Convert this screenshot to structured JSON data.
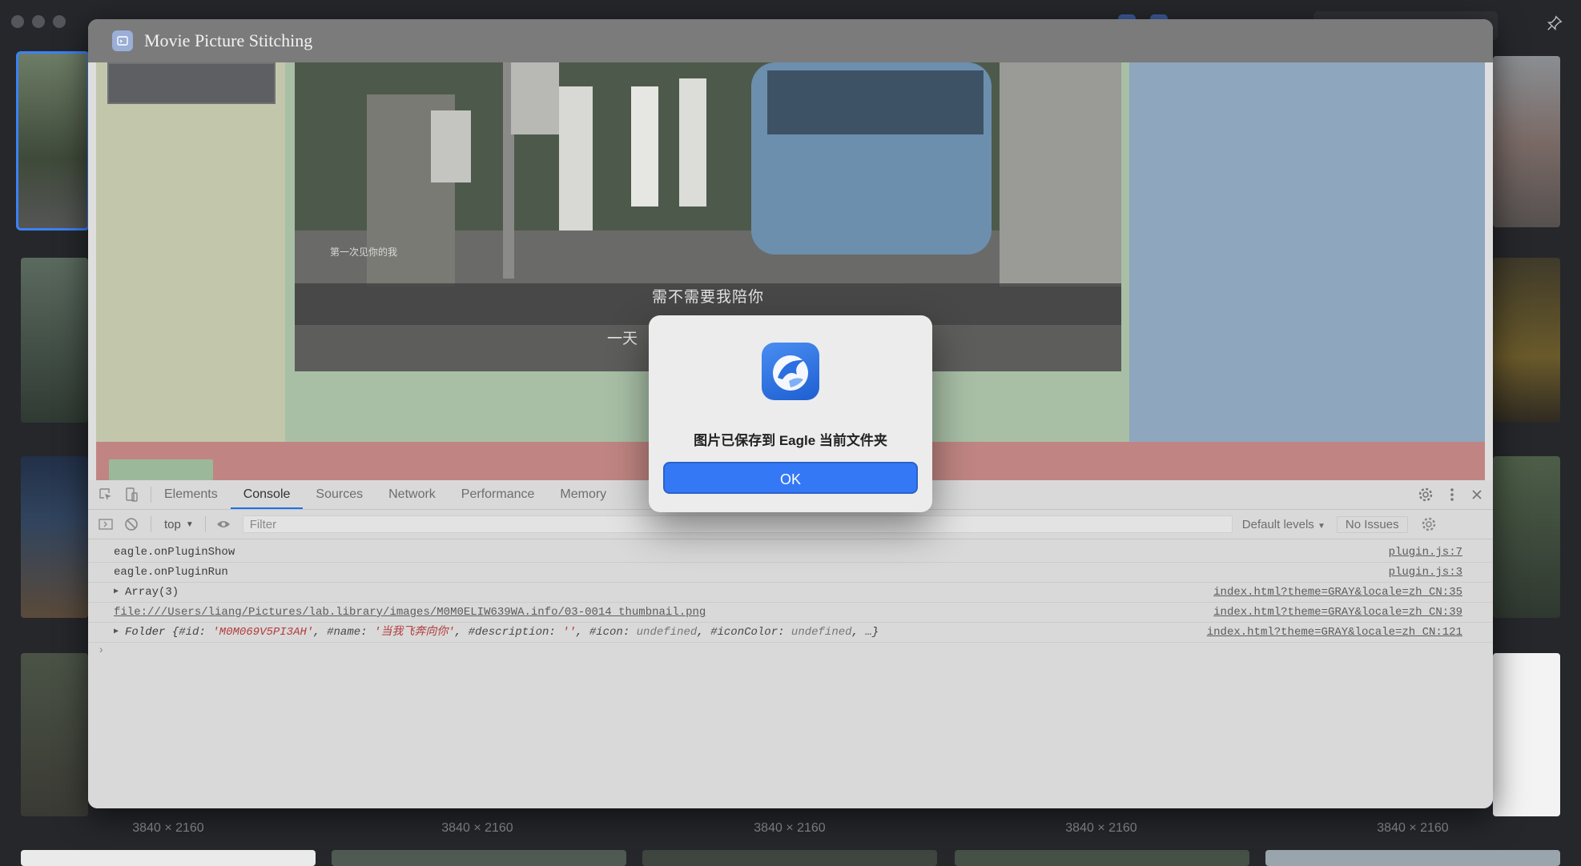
{
  "plugin": {
    "title": "Movie Picture Stitching"
  },
  "movie": {
    "caption_top": "需不需要我陪你",
    "caption_bottom": "一天",
    "caption_small": "第一次见你的我"
  },
  "devtools": {
    "tabs": [
      "Elements",
      "Console",
      "Sources",
      "Network",
      "Performance",
      "Memory"
    ],
    "active_tab": "Console",
    "context": "top",
    "filter_placeholder": "Filter",
    "levels": "Default levels",
    "issues": "No Issues",
    "console": [
      {
        "text": "eagle.onPluginShow",
        "source": "plugin.js:7"
      },
      {
        "text": "eagle.onPluginRun",
        "source": "plugin.js:3"
      },
      {
        "text": "Array(3)",
        "source": "index.html?theme=GRAY&locale=zh_CN:35"
      },
      {
        "text": "file:///Users/liang/Pictures/lab.library/images/M0M0ELIW639WA.info/03-0014 thumbnail.png",
        "source": "index.html?theme=GRAY&locale=zh_CN:39"
      },
      {
        "text": "Folder",
        "source": "index.html?theme=GRAY&locale=zh_CN:121"
      }
    ],
    "folder_object": {
      "id_key": "#id",
      "id": "'M0M069V5PI3AH'",
      "name_key": "#name",
      "name": "'当我飞奔向你'",
      "desc_key": "#description",
      "desc": "''",
      "icon_key": "#icon",
      "icon": "undefined",
      "iconcolor_key": "#iconColor",
      "iconcolor": "undefined",
      "tail": "…}"
    }
  },
  "dialog": {
    "message": "图片已保存到 Eagle 当前文件夹",
    "ok_label": "OK"
  },
  "grid": {
    "dimension_labels": [
      "3840 × 2160",
      "3840 × 2160",
      "3840 × 2160",
      "3840 × 2160",
      "3840 × 2160"
    ]
  },
  "colors": {
    "accent": "#3478f6",
    "canvas_yellow": "#c2c7ac",
    "canvas_green": "#a8bfa6",
    "canvas_blue": "#8fa6bf",
    "canvas_red": "#c08582"
  }
}
